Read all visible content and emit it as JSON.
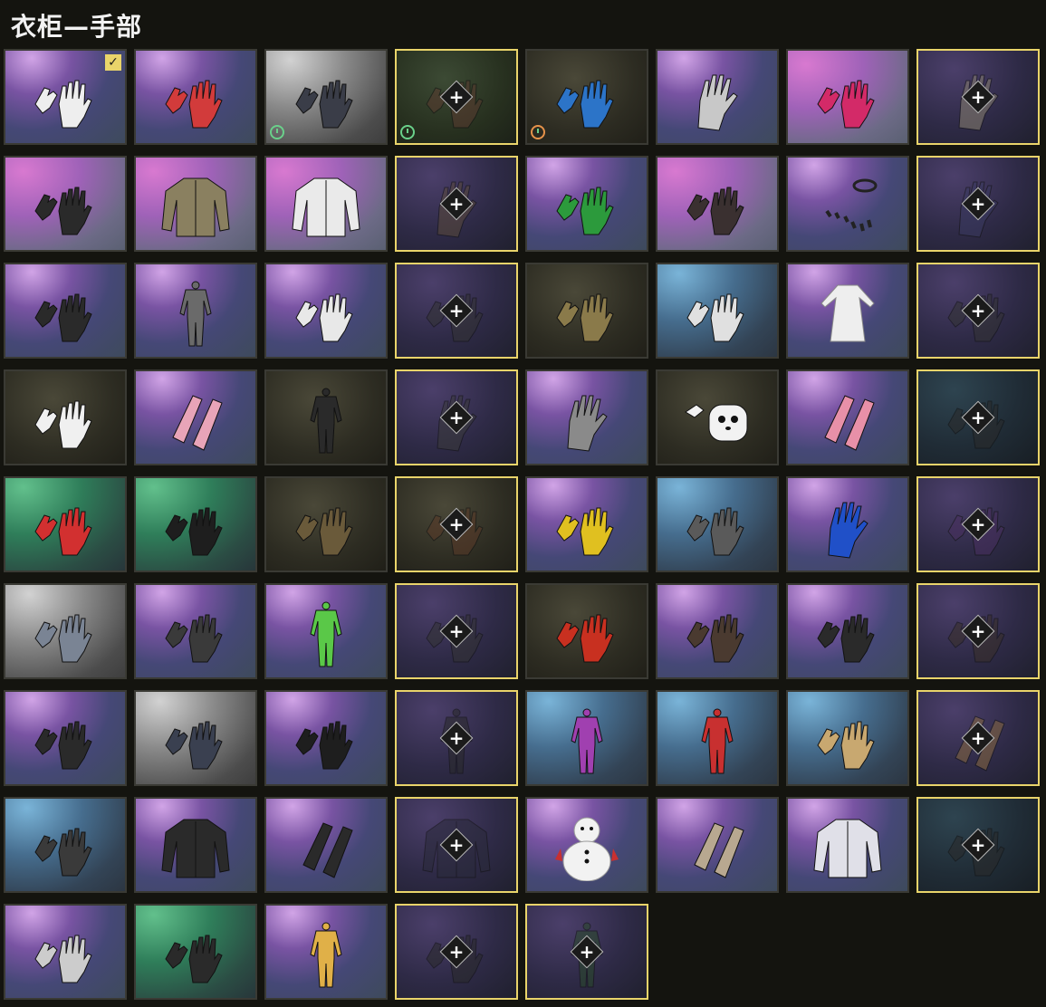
{
  "title": "衣柜—手部",
  "items": [
    {
      "name": "white-fingerless-gloves",
      "bg": "purple",
      "color": "#eeeeee",
      "kind": "gloves",
      "equipped": true
    },
    {
      "name": "white-red-racing-gloves",
      "bg": "purple",
      "color": "#d23b3b",
      "kind": "gloves"
    },
    {
      "name": "dark-fingerless-gloves",
      "bg": "gray",
      "color": "#3a3d48",
      "kind": "gloves",
      "timer": "green"
    },
    {
      "name": "brown-gloves-locked",
      "bg": "darkgreen",
      "color": "#5a3b30",
      "kind": "gloves",
      "locked": true,
      "timer": "green"
    },
    {
      "name": "blue-racing-gloves",
      "bg": "dark",
      "color": "#2c74c8",
      "kind": "gloves",
      "timer": "orange"
    },
    {
      "name": "white-painted-hand",
      "bg": "purple",
      "color": "#c8c8c8",
      "kind": "hand"
    },
    {
      "name": "pink-racing-gloves",
      "bg": "pink",
      "color": "#d32a68",
      "kind": "gloves"
    },
    {
      "name": "bandaged-hand-locked",
      "bg": "dpurple",
      "color": "#8a8270",
      "kind": "hand",
      "locked": true
    },
    {
      "name": "black-fingerless-gloves",
      "bg": "pink",
      "color": "#2a2a2a",
      "kind": "gloves"
    },
    {
      "name": "camo-jacket",
      "bg": "pink",
      "color": "#8a8060",
      "kind": "jacket"
    },
    {
      "name": "white-tied-shirt",
      "bg": "pink",
      "color": "#eaeaea",
      "kind": "jacket"
    },
    {
      "name": "leather-bracer-locked",
      "bg": "dpurple",
      "color": "#5a4a3a",
      "kind": "hand",
      "locked": true
    },
    {
      "name": "green-racing-gloves",
      "bg": "purple",
      "color": "#2c9a3c",
      "kind": "gloves"
    },
    {
      "name": "studded-fingerless-gloves",
      "bg": "pink",
      "color": "#3a3030",
      "kind": "gloves"
    },
    {
      "name": "black-claws-bracelet",
      "bg": "purple",
      "color": "#222222",
      "kind": "claws"
    },
    {
      "name": "blue-glove-locked",
      "bg": "dpurple",
      "color": "#3a3a60",
      "kind": "hand",
      "locked": true
    },
    {
      "name": "black-knit-gloves",
      "bg": "purple",
      "color": "#2a2a2a",
      "kind": "gloves"
    },
    {
      "name": "gray-jumpsuit",
      "bg": "purple",
      "color": "#6a6a6a",
      "kind": "suit"
    },
    {
      "name": "white-gloves",
      "bg": "purple",
      "color": "#e8e8e8",
      "kind": "gloves"
    },
    {
      "name": "black-tactical-gloves-locked",
      "bg": "dpurple",
      "color": "#333333",
      "kind": "gloves",
      "locked": true
    },
    {
      "name": "gold-armored-gloves",
      "bg": "dark",
      "color": "#8a7a4a",
      "kind": "gloves"
    },
    {
      "name": "white-knuckle-gloves",
      "bg": "blue",
      "color": "#e0e0e0",
      "kind": "gloves"
    },
    {
      "name": "white-frill-dress",
      "bg": "purple",
      "color": "#eeeeee",
      "kind": "dress"
    },
    {
      "name": "black-studded-gloves-locked",
      "bg": "dpurple",
      "color": "#333333",
      "kind": "gloves",
      "locked": true
    },
    {
      "name": "skeleton-gloves",
      "bg": "dark",
      "color": "#f0f0f0",
      "kind": "gloves"
    },
    {
      "name": "pink-sleeves",
      "bg": "purple",
      "color": "#e8a4b8",
      "kind": "sleeve"
    },
    {
      "name": "black-suit",
      "bg": "dark",
      "color": "#2a2a2a",
      "kind": "suit"
    },
    {
      "name": "black-painted-hand-locked",
      "bg": "dpurple",
      "color": "#3a3a3a",
      "kind": "hand",
      "locked": true
    },
    {
      "name": "gray-sleeve-hand",
      "bg": "purple",
      "color": "#8a8a8a",
      "kind": "hand"
    },
    {
      "name": "panda-mitten",
      "bg": "dark",
      "color": "#f2f2f2",
      "kind": "mitten"
    },
    {
      "name": "pink-knit-sleeve",
      "bg": "purple",
      "color": "#e890a8",
      "kind": "sleeve"
    },
    {
      "name": "dark-knit-gloves-locked",
      "bg": "dblue",
      "color": "#2a2a2a",
      "kind": "gloves",
      "locked": true
    },
    {
      "name": "red-snowflake-gloves",
      "bg": "green",
      "color": "#d23030",
      "kind": "gloves"
    },
    {
      "name": "black-leather-gloves",
      "bg": "green",
      "color": "#1e1e1e",
      "kind": "gloves"
    },
    {
      "name": "brown-fingerless-gloves",
      "bg": "dark",
      "color": "#6a5a3a",
      "kind": "gloves"
    },
    {
      "name": "brown-leather-gloves-locked",
      "bg": "dark",
      "color": "#5a3a28",
      "kind": "gloves",
      "locked": true
    },
    {
      "name": "yellow-blue-gloves",
      "bg": "purple",
      "color": "#e0c020",
      "kind": "gloves"
    },
    {
      "name": "studded-gray-fingerless",
      "bg": "blue",
      "color": "#5a5a5a",
      "kind": "gloves"
    },
    {
      "name": "blue-latex-glove",
      "bg": "purple",
      "color": "#2050c8",
      "kind": "hand"
    },
    {
      "name": "purple-gloves-locked",
      "bg": "dpurple",
      "color": "#4a3060",
      "kind": "gloves",
      "locked": true
    },
    {
      "name": "gray-blue-fingerless",
      "bg": "gray",
      "color": "#7a8494",
      "kind": "gloves"
    },
    {
      "name": "armored-knuckle-gloves",
      "bg": "purple",
      "color": "#3a3a3a",
      "kind": "gloves"
    },
    {
      "name": "green-white-suit",
      "bg": "purple",
      "color": "#5ac848",
      "kind": "suit"
    },
    {
      "name": "black-gloves-locked",
      "bg": "dpurple",
      "color": "#333333",
      "kind": "gloves",
      "locked": true
    },
    {
      "name": "red-black-racing-gloves",
      "bg": "dark",
      "color": "#c83020",
      "kind": "gloves"
    },
    {
      "name": "orange-trim-gloves",
      "bg": "purple",
      "color": "#4a3a30",
      "kind": "gloves"
    },
    {
      "name": "laced-fingerless-gloves",
      "bg": "purple",
      "color": "#2a2a2a",
      "kind": "gloves"
    },
    {
      "name": "gold-trim-gloves-locked",
      "bg": "dpurple",
      "color": "#3a3028",
      "kind": "gloves",
      "locked": true
    },
    {
      "name": "black-white-gloves",
      "bg": "purple",
      "color": "#2a2a2a",
      "kind": "gloves"
    },
    {
      "name": "blue-armored-gloves",
      "bg": "gray",
      "color": "#3a4050",
      "kind": "gloves"
    },
    {
      "name": "black-knuckle-gloves",
      "bg": "purple",
      "color": "#1e1e1e",
      "kind": "gloves"
    },
    {
      "name": "black-coat-locked",
      "bg": "dpurple",
      "color": "#2a2a2a",
      "kind": "suit",
      "locked": true
    },
    {
      "name": "purple-bodysuit",
      "bg": "blue",
      "color": "#a040b0",
      "kind": "suit"
    },
    {
      "name": "red-white-bodysuit",
      "bg": "blue",
      "color": "#c83030",
      "kind": "suit"
    },
    {
      "name": "tan-racing-gloves",
      "bg": "blue",
      "color": "#c8a870",
      "kind": "gloves"
    },
    {
      "name": "floral-sleeves-locked",
      "bg": "dpurple",
      "color": "#8a6a40",
      "kind": "sleeve",
      "locked": true
    },
    {
      "name": "dark-wrap-gloves",
      "bg": "blue",
      "color": "#3a3a3a",
      "kind": "gloves"
    },
    {
      "name": "black-leather-jacket",
      "bg": "purple",
      "color": "#2a2a2a",
      "kind": "jacket"
    },
    {
      "name": "black-bandage-sleeves",
      "bg": "purple",
      "color": "#2a2a2a",
      "kind": "sleeve"
    },
    {
      "name": "hooded-cloak-locked",
      "bg": "dpurple",
      "color": "#2a2a3a",
      "kind": "jacket",
      "locked": true
    },
    {
      "name": "snowman-suit",
      "bg": "purple",
      "color": "#f2f2f2",
      "kind": "snowman"
    },
    {
      "name": "tan-bandage-sleeves",
      "bg": "purple",
      "color": "#b8a890",
      "kind": "sleeve"
    },
    {
      "name": "white-hooded-jacket",
      "bg": "purple",
      "color": "#e0e0e8",
      "kind": "jacket"
    },
    {
      "name": "dark-gloves-locked",
      "bg": "dblue",
      "color": "#2a2a2a",
      "kind": "gloves",
      "locked": true
    },
    {
      "name": "white-knit-fingerless",
      "bg": "purple",
      "color": "#cccccc",
      "kind": "gloves"
    },
    {
      "name": "red-studded-gloves",
      "bg": "green",
      "color": "#2a2a2a",
      "kind": "gloves"
    },
    {
      "name": "yellow-jumpsuit",
      "bg": "purple",
      "color": "#e0b048",
      "kind": "suit"
    },
    {
      "name": "black-tactical-locked-2",
      "bg": "dpurple",
      "color": "#2a2a2a",
      "kind": "gloves",
      "locked": true
    },
    {
      "name": "green-suit-locked",
      "bg": "dpurple",
      "color": "#2a4a2a",
      "kind": "suit",
      "locked": true
    }
  ]
}
